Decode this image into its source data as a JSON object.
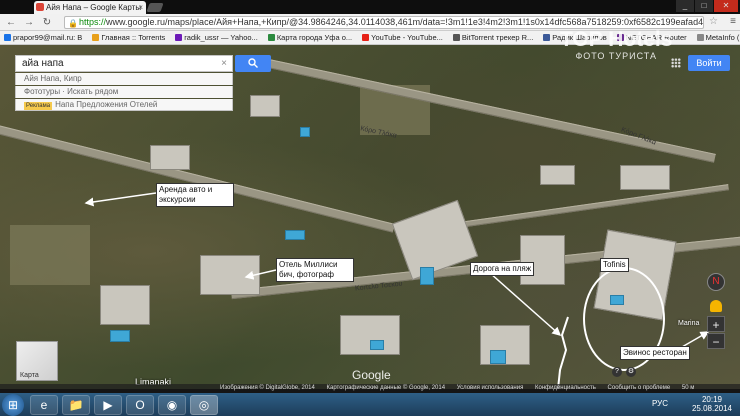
{
  "browser": {
    "tab_title": "Айя Напа – Google Карты",
    "tab_close": "×",
    "url_https": "https://",
    "url_rest": "www.google.ru/maps/place/Айя+Напа,+Кипр/@34.9864246,34.0114038,461m/data=!3m1!1e3!4m2!3m1!1s0x14dfc568a7518259:0xf6582c199eafad40",
    "back": "←",
    "forward": "→",
    "reload": "↻",
    "star": "☆",
    "menu": "≡",
    "win_min": "_",
    "win_max": "□",
    "win_close": "✕"
  },
  "bookmarks": [
    {
      "label": "prapor99@mail.ru: В",
      "color": "#1a73e8"
    },
    {
      "label": "Главная :: Torrents",
      "color": "#e8a01a"
    },
    {
      "label": "radik_ussr — Yahoo...",
      "color": "#6d1ab8"
    },
    {
      "label": "Карта города Уфа о...",
      "color": "#2b8a3e"
    },
    {
      "label": "YouTube - YouTube...",
      "color": "#e62117"
    },
    {
      "label": "BitTorrent трекер R...",
      "color": "#555555"
    },
    {
      "label": "Радик Шарипов",
      "color": "#3b5998"
    },
    {
      "label": "NETGEAR Router",
      "color": "#6a2c91"
    },
    {
      "label": "MetaInfo (Ex divi)...",
      "color": "#888888"
    }
  ],
  "search": {
    "value": "айа напа",
    "clear": "×",
    "button_icon": "search-icon",
    "suggestions": [
      {
        "text": "Айя Напа, Кипр"
      },
      {
        "text": "Фототуры · Искать рядом"
      },
      {
        "ad": "Реклама",
        "text": "Напа Предложения Отелей"
      }
    ]
  },
  "header": {
    "signin": "Войти",
    "apps_icon": "apps-grid-icon"
  },
  "watermark": {
    "big": "TOP Hotels",
    "small": "ФОТО ТУРИСТА"
  },
  "callouts": {
    "car_rental": "Аренда авто и экскурсии",
    "hotel": "Отель Миллиси бич, фотограф",
    "beach_road": "Дорога на пляж",
    "tofinis": "Tofinis",
    "restaurant": "Эвинос ресторан"
  },
  "map_labels": {
    "road1": "Кόρο Тλάκα",
    "road2": "Κοπελο Τσεκου",
    "road3": "Κόρο Γλάκα",
    "place1": "Marina",
    "limanaki": "Limanaki",
    "google": "Google"
  },
  "controls": {
    "compass": "N",
    "zoom_in": "+",
    "zoom_out": "−",
    "map_thumb_label": "Карта",
    "help": "?",
    "settings": "⚙"
  },
  "footer": [
    "Изображения © DigitalGlobe, 2014",
    "Картографические данные © Google, 2014",
    "Условия использования",
    "Конфиденциальность",
    "Сообщить о проблеме",
    "50 м"
  ],
  "taskbar": {
    "start": "⊞",
    "apps": [
      "e",
      "📁",
      "▶",
      "O",
      "◉",
      "◎"
    ],
    "lang": "РУС",
    "time": "20:19",
    "date": "25.08.2014"
  }
}
